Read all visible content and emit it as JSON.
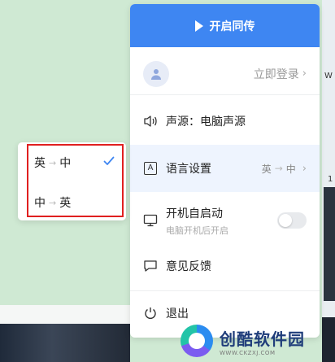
{
  "header": {
    "start_sync_label": "开启同传"
  },
  "user": {
    "login_label": "立即登录"
  },
  "menu": {
    "source_label": "声源：电脑声源",
    "language_label": "语言设置",
    "language_from": "英",
    "language_to": "中",
    "autostart_label": "开机自启动",
    "autostart_sub": "电脑开机后开启",
    "autostart_enabled": false,
    "feedback_label": "意见反馈",
    "exit_label": "退出"
  },
  "language_submenu": {
    "items": [
      {
        "from": "英",
        "to": "中",
        "selected": true
      },
      {
        "from": "中",
        "to": "英",
        "selected": false
      }
    ]
  },
  "background": {
    "edge_label_1": "W",
    "edge_label_2": "1"
  },
  "watermark": {
    "brand_cn": "创酷软件园",
    "brand_url": "WWW.CKZXJ.COM"
  },
  "colors": {
    "accent": "#3e86f2",
    "highlight_border": "#e02020",
    "selected_row": "#eef4fe"
  }
}
